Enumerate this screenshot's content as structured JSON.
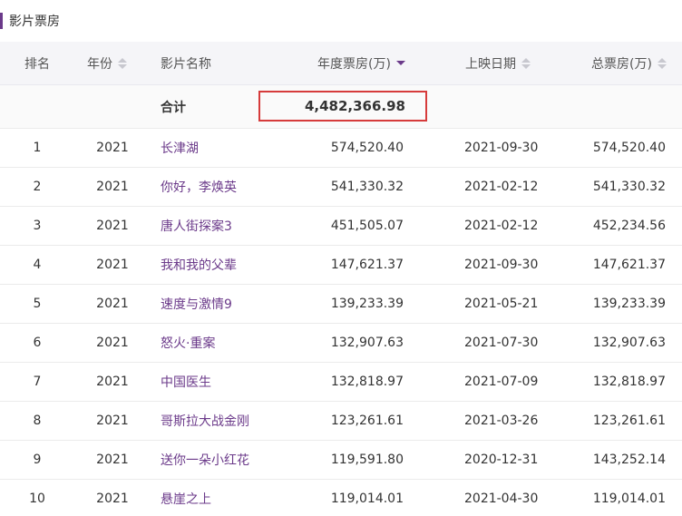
{
  "section": {
    "title": "影片票房"
  },
  "colors": {
    "accent": "#6b3a8a",
    "highlight_border": "#d63b3b"
  },
  "table": {
    "headers": {
      "rank": "排名",
      "year": "年份",
      "name": "影片名称",
      "annual_box": "年度票房(万)",
      "release_date": "上映日期",
      "total_box": "总票房(万)"
    },
    "sort": {
      "active_column": "annual_box",
      "direction": "desc"
    },
    "total_row": {
      "label": "合计",
      "annual_box": "4,482,366.98"
    },
    "rows": [
      {
        "rank": "1",
        "year": "2021",
        "name": "长津湖",
        "annual_box": "574,520.40",
        "release_date": "2021-09-30",
        "total_box": "574,520.40"
      },
      {
        "rank": "2",
        "year": "2021",
        "name": "你好，李焕英",
        "annual_box": "541,330.32",
        "release_date": "2021-02-12",
        "total_box": "541,330.32"
      },
      {
        "rank": "3",
        "year": "2021",
        "name": "唐人街探案3",
        "annual_box": "451,505.07",
        "release_date": "2021-02-12",
        "total_box": "452,234.56"
      },
      {
        "rank": "4",
        "year": "2021",
        "name": "我和我的父辈",
        "annual_box": "147,621.37",
        "release_date": "2021-09-30",
        "total_box": "147,621.37"
      },
      {
        "rank": "5",
        "year": "2021",
        "name": "速度与激情9",
        "annual_box": "139,233.39",
        "release_date": "2021-05-21",
        "total_box": "139,233.39"
      },
      {
        "rank": "6",
        "year": "2021",
        "name": "怒火·重案",
        "annual_box": "132,907.63",
        "release_date": "2021-07-30",
        "total_box": "132,907.63"
      },
      {
        "rank": "7",
        "year": "2021",
        "name": "中国医生",
        "annual_box": "132,818.97",
        "release_date": "2021-07-09",
        "total_box": "132,818.97"
      },
      {
        "rank": "8",
        "year": "2021",
        "name": "哥斯拉大战金刚",
        "annual_box": "123,261.61",
        "release_date": "2021-03-26",
        "total_box": "123,261.61"
      },
      {
        "rank": "9",
        "year": "2021",
        "name": "送你一朵小红花",
        "annual_box": "119,591.80",
        "release_date": "2020-12-31",
        "total_box": "143,252.14"
      },
      {
        "rank": "10",
        "year": "2021",
        "name": "悬崖之上",
        "annual_box": "119,014.01",
        "release_date": "2021-04-30",
        "total_box": "119,014.01"
      }
    ]
  }
}
